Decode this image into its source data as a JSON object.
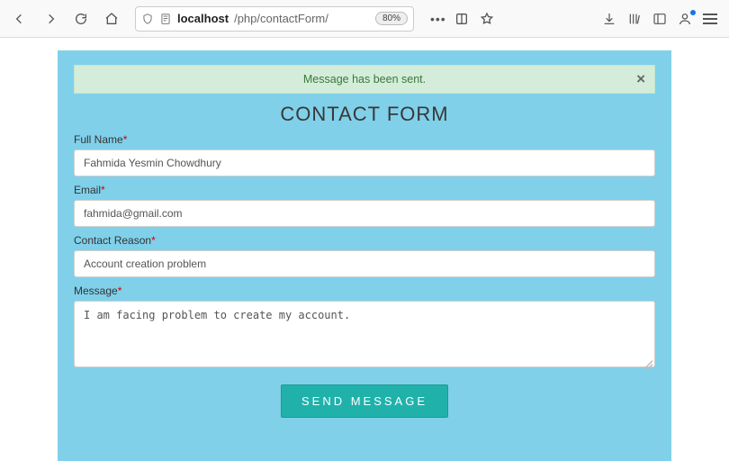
{
  "browser": {
    "url_host": "localhost",
    "url_path": "/php/contactForm/",
    "zoom": "80%"
  },
  "alert": {
    "text": "Message has been sent.",
    "close": "×"
  },
  "form": {
    "title": "CONTACT FORM",
    "fullName": {
      "label": "Full Name",
      "value": "Fahmida Yesmin Chowdhury"
    },
    "email": {
      "label": "Email",
      "value": "fahmida@gmail.com"
    },
    "reason": {
      "label": "Contact Reason",
      "value": "Account creation problem"
    },
    "message": {
      "label": "Message",
      "value": "I am facing problem to create my account."
    },
    "required_mark": "*",
    "submit": "SEND MESSAGE"
  }
}
